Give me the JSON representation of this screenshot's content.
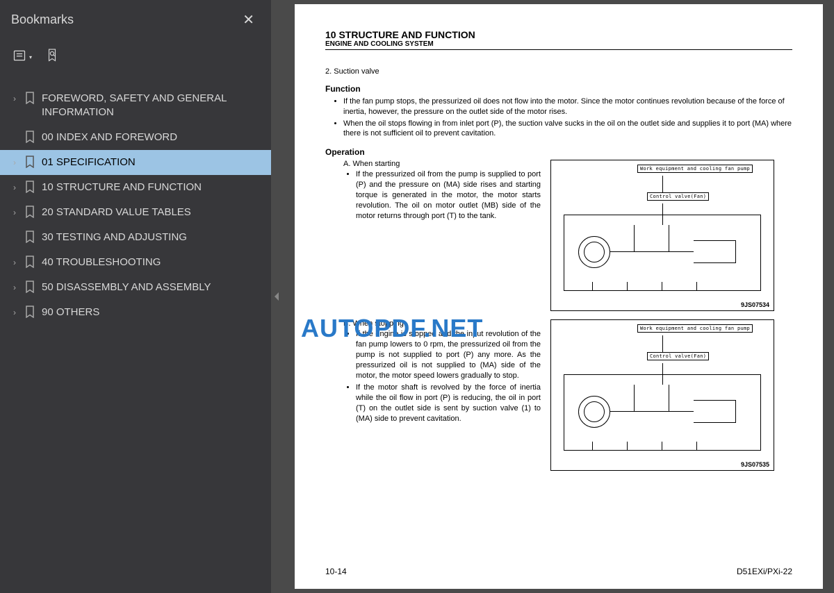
{
  "sidebar": {
    "title": "Bookmarks",
    "items": [
      {
        "label": "FOREWORD, SAFETY AND GENERAL INFORMATION",
        "expandable": true
      },
      {
        "label": "00 INDEX AND FOREWORD",
        "expandable": false
      },
      {
        "label": "01 SPECIFICATION",
        "expandable": true,
        "selected": true
      },
      {
        "label": "10 STRUCTURE AND FUNCTION",
        "expandable": true
      },
      {
        "label": "20 STANDARD VALUE TABLES",
        "expandable": true
      },
      {
        "label": "30 TESTING AND ADJUSTING",
        "expandable": false
      },
      {
        "label": "40 TROUBLESHOOTING",
        "expandable": true
      },
      {
        "label": "50 DISASSEMBLY AND ASSEMBLY",
        "expandable": true
      },
      {
        "label": "90 OTHERS",
        "expandable": true
      }
    ]
  },
  "watermark": "AUTOPDF.NET",
  "page": {
    "chapter": "10 STRUCTURE AND FUNCTION",
    "subtitle": "ENGINE AND COOLING SYSTEM",
    "section_number": "2.   Suction valve",
    "function_heading": "Function",
    "function_bullets": [
      "If the fan pump stops, the pressurized oil does not flow into the motor. Since the motor continues revolution because of the force of inertia, however, the pressure on the outlet side of the motor rises.",
      "When the oil stops flowing in from inlet port (P), the suction valve sucks in the oil on the outlet side and supplies it to port (MA) where there is not sufficient oil to prevent cavitation."
    ],
    "operation_heading": "Operation",
    "op_a": {
      "letter": "A.   When starting",
      "bullets": [
        "If the pressurized oil from the pump is supplied to port (P) and the pressure on (MA) side rises and starting torque is generated in the motor, the motor starts revolution. The oil on motor outlet (MB) side of the motor returns through port (T) to the tank."
      ]
    },
    "op_b": {
      "letter": "B.   When stopping",
      "bullets": [
        "If the engine is stopped and the input revolution of the fan pump lowers to 0 rpm, the pressurized oil from the pump is not supplied to port (P) any more. As the pressurized oil is not supplied to (MA) side of the motor, the motor speed lowers gradually to stop.",
        "If the motor shaft is revolved by the force of inertia while the oil flow in port (P) is reducing, the oil in port (T) on the outlet side is sent by suction valve (1) to (MA) side to prevent cavitation."
      ]
    },
    "diagram_labels": {
      "top": "Work equipment and cooling fan pump",
      "mid": "Control valve(Fan)"
    },
    "diagram_code_1": "9JS07534",
    "diagram_code_2": "9JS07535",
    "footer_left": "10-14",
    "footer_right": "D51EXi/PXi-22"
  }
}
